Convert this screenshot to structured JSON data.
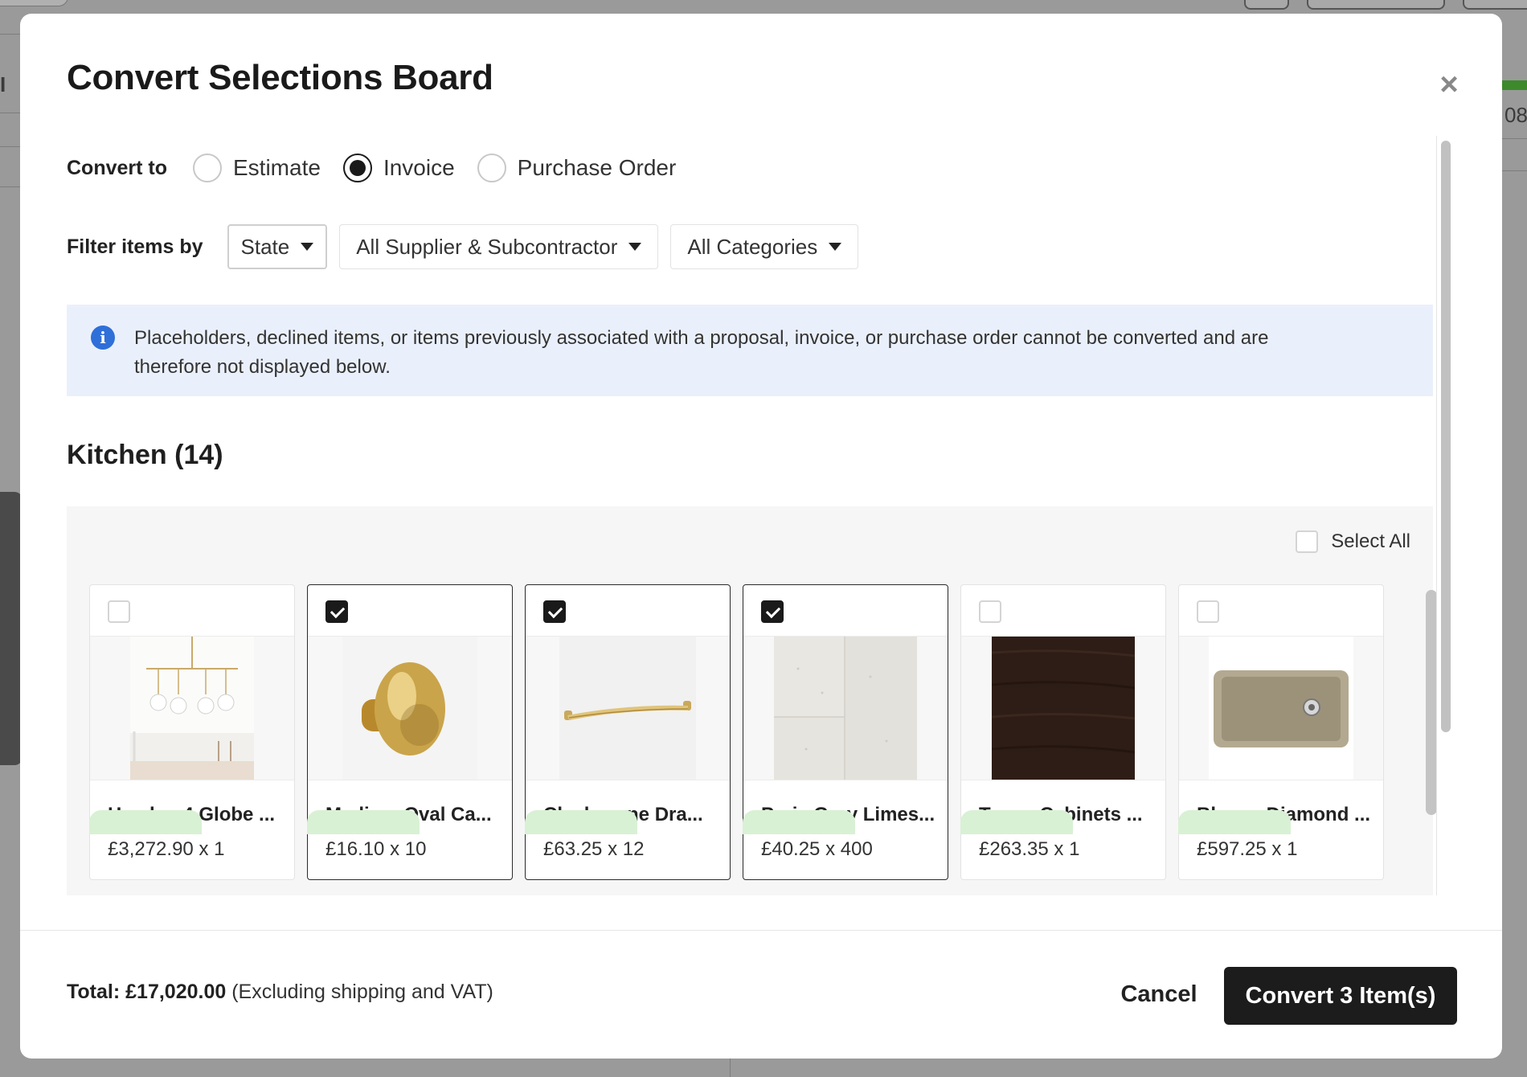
{
  "background": {
    "partial_text": "08"
  },
  "modal": {
    "title": "Convert Selections Board",
    "close_label": "×",
    "convert_to": {
      "label": "Convert to",
      "options": [
        {
          "label": "Estimate",
          "checked": false
        },
        {
          "label": "Invoice",
          "checked": true
        },
        {
          "label": "Purchase Order",
          "checked": false
        }
      ]
    },
    "filter": {
      "label": "Filter items by",
      "dropdowns": [
        {
          "label": "State"
        },
        {
          "label": "All Supplier & Subcontractor"
        },
        {
          "label": "All Categories"
        }
      ]
    },
    "info": {
      "icon": "info-icon",
      "line1": "Placeholders, declined items, or items previously associated with a proposal, invoice, or purchase order cannot be converted and are",
      "line2": "therefore not displayed below."
    },
    "section": {
      "title": "Kitchen (14)",
      "select_all_label": "Select All",
      "items": [
        {
          "name": "Hayden 4 Globe ...",
          "price": "£3,272.90 x 1",
          "selected": false
        },
        {
          "name": "Medium Oval Ca...",
          "price": "£16.10 x 10",
          "selected": true
        },
        {
          "name": "Claybourne Dra...",
          "price": "£63.25 x 12",
          "selected": true
        },
        {
          "name": "Paris Grey Limes...",
          "price": "£40.25 x 400",
          "selected": true
        },
        {
          "name": "Tower Cabinets ...",
          "price": "£263.35 x 1",
          "selected": false
        },
        {
          "name": "Blanco Diamond ...",
          "price": "£597.25 x 1",
          "selected": false
        }
      ]
    },
    "footer": {
      "total_label": "Total:",
      "total_value": "£17,020.00",
      "total_note": "(Excluding shipping and VAT)",
      "cancel_label": "Cancel",
      "convert_label": "Convert 3 Item(s)"
    }
  },
  "colors": {
    "accent": "#1c1c1c",
    "info_bg": "#eaf0fb",
    "info_icon": "#2f6fd8",
    "status_pill": "#d8f1d4"
  }
}
